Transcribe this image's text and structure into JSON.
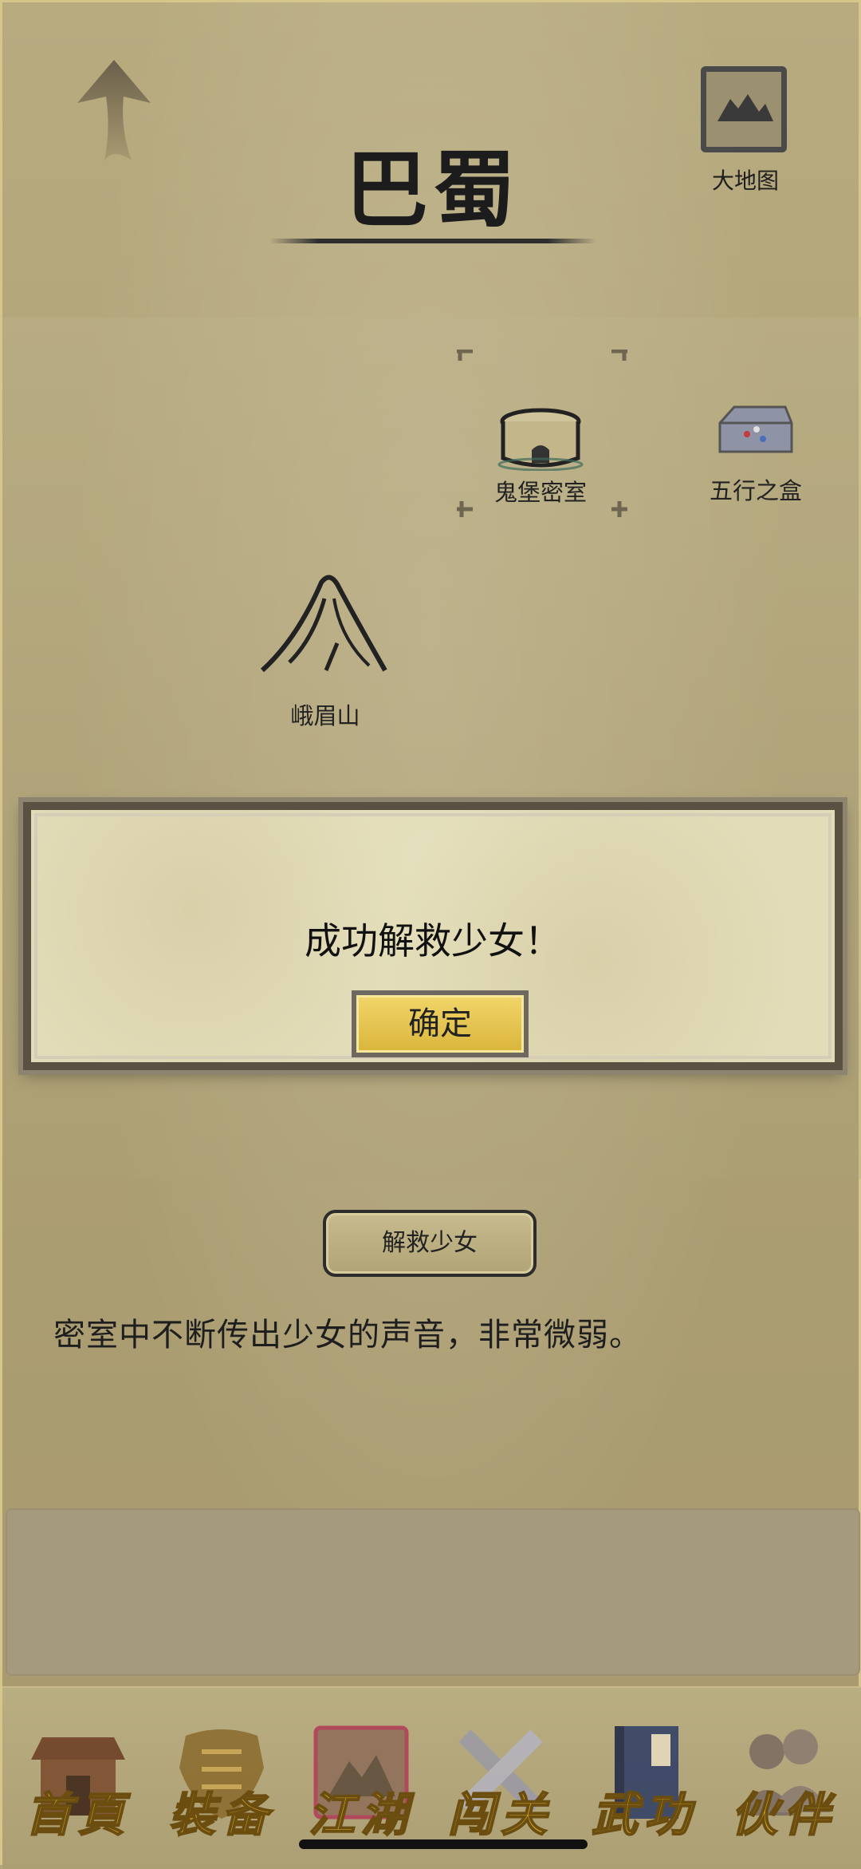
{
  "header": {
    "title": "巴蜀",
    "back_icon": "up-arrow-icon",
    "big_map_label": "大地图",
    "big_map_icon": "mountain-map-icon"
  },
  "map": {
    "locations": [
      {
        "name": "鬼堡密室",
        "icon": "castle-icon",
        "selected": true
      },
      {
        "name": "五行之盒",
        "icon": "box-icon"
      },
      {
        "name": "峨眉山",
        "icon": "mountain-icon"
      }
    ]
  },
  "action": {
    "button_label": "解救少女"
  },
  "story": {
    "text": "密室中不断传出少女的声音，非常微弱。"
  },
  "modal": {
    "message": "成功解救少女！",
    "ok_label": "确定"
  },
  "nav": {
    "items": [
      {
        "label": "首頁",
        "icon": "house-icon"
      },
      {
        "label": "裝备",
        "icon": "armor-icon"
      },
      {
        "label": "江湖",
        "icon": "scroll-map-icon",
        "active": true
      },
      {
        "label": "闯关",
        "icon": "crossed-swords-icon"
      },
      {
        "label": "武功",
        "icon": "book-icon"
      },
      {
        "label": "伙伴",
        "icon": "people-icon"
      }
    ]
  },
  "colors": {
    "parchment": "#b3a57a",
    "nav_gold": "#c7a227",
    "ok_button": "#e5c24c",
    "frame": "#5a5142"
  }
}
